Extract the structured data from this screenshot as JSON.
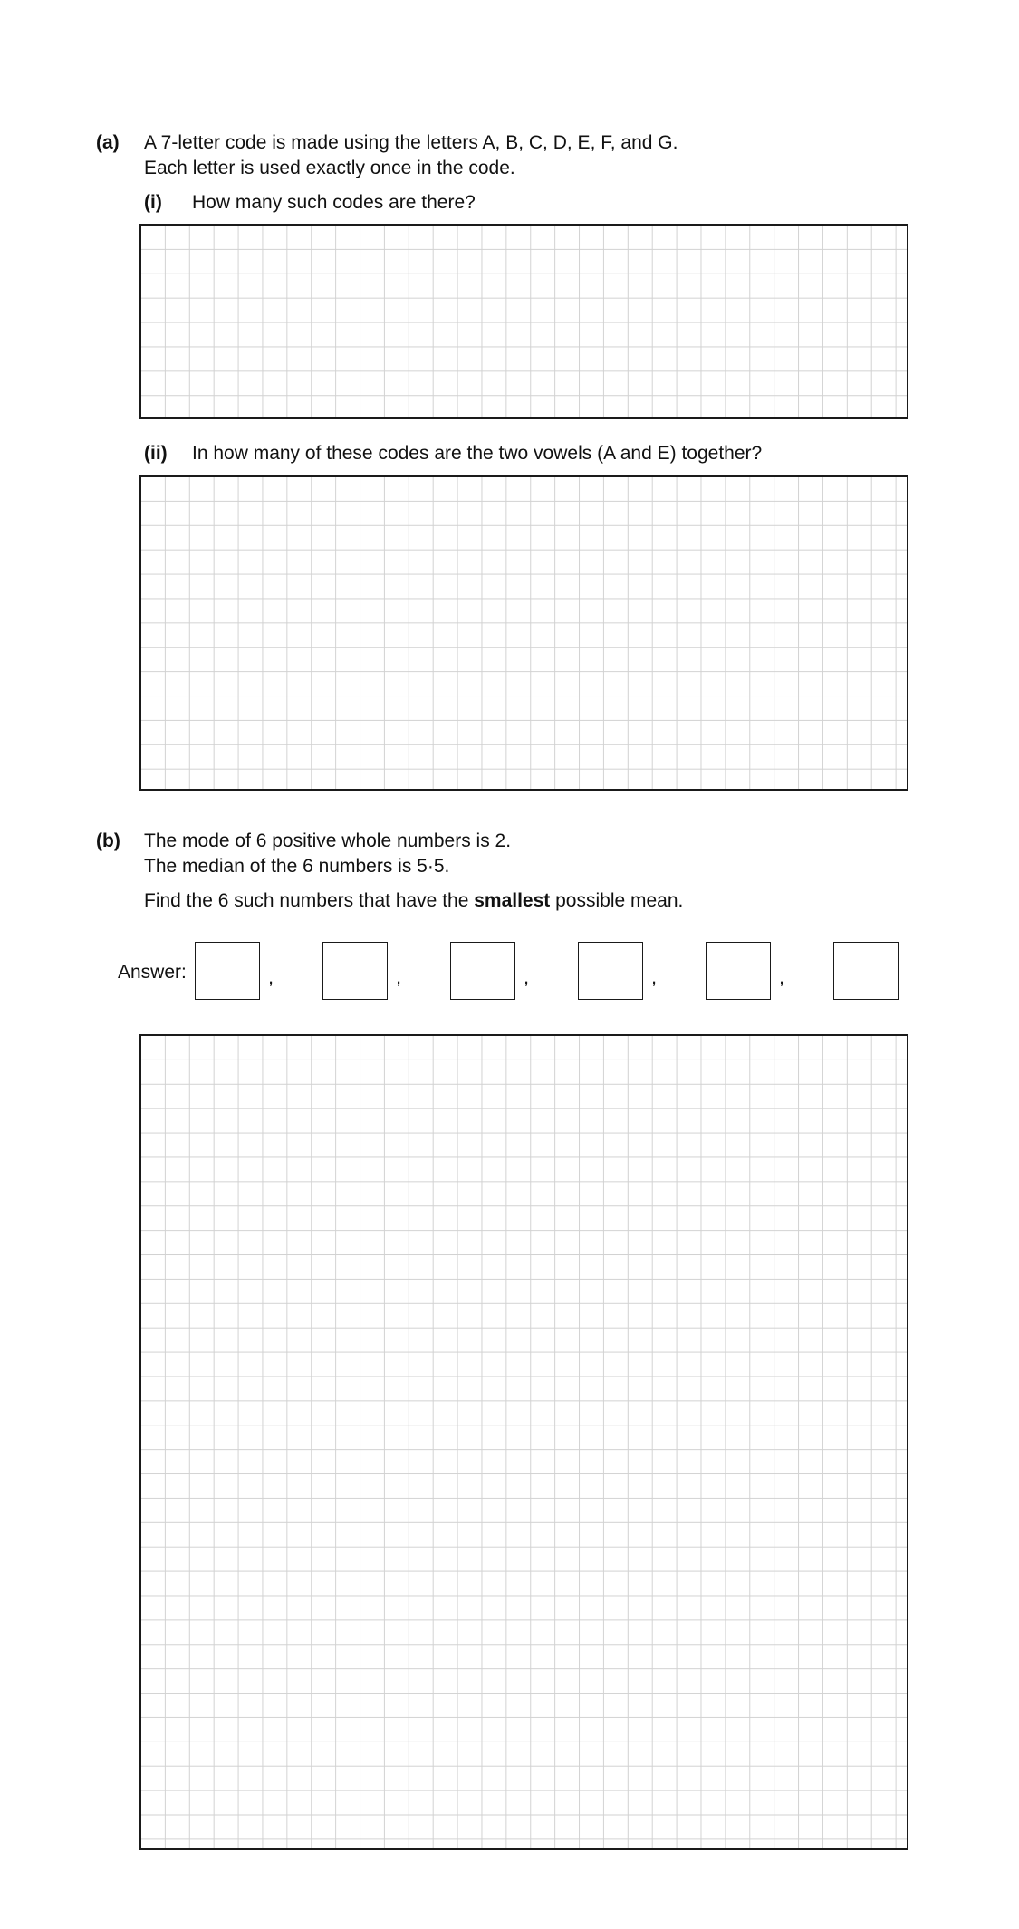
{
  "part_a": {
    "label": "(a)",
    "line1": "A 7-letter code is made using the letters A, B, C, D, E, F, and G.",
    "line2": "Each letter is used exactly once in the code.",
    "sub_i": {
      "label": "(i)",
      "question": "How many such codes are there?"
    },
    "sub_ii": {
      "label": "(ii)",
      "question": "In how many of these codes are the two vowels (A and E) together?"
    }
  },
  "part_b": {
    "label": "(b)",
    "line1": "The mode of 6 positive whole numbers is 2.",
    "line2": "The median of the 6 numbers is 5·5.",
    "instruction_before": "Find the 6 such numbers that have the ",
    "instruction_bold": "smallest",
    "instruction_after": " possible mean.",
    "answer_label": "Answer:",
    "separator": ",",
    "answer_values": [
      "",
      "",
      "",
      "",
      "",
      ""
    ]
  }
}
